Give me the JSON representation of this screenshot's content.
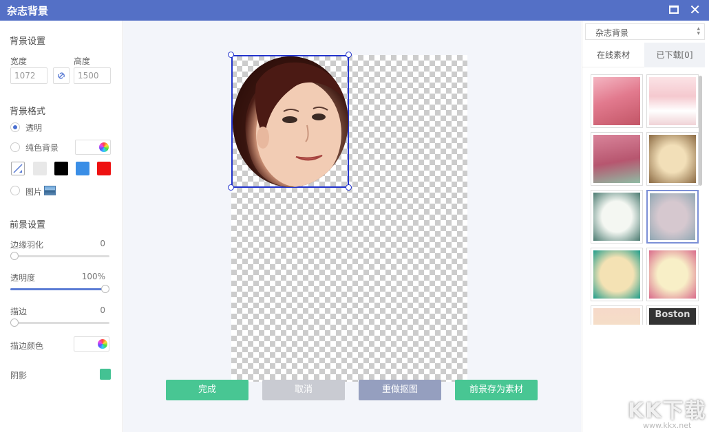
{
  "window": {
    "title": "杂志背景"
  },
  "left": {
    "bg_settings_title": "背景设置",
    "width_label": "宽度",
    "height_label": "高度",
    "width_value": "1072",
    "height_value": "1500",
    "bg_format_title": "背景格式",
    "opt_transparent": "透明",
    "opt_solid": "纯色背景",
    "opt_image": "图片",
    "swatches": [
      "#e8e8e8",
      "#000000",
      "#3a8ee6",
      "#ee1111"
    ],
    "fg_settings_title": "前景设置",
    "feather_label": "边缘羽化",
    "feather_value": "0",
    "feather_level": 0,
    "opacity_label": "透明度",
    "opacity_value": "100%",
    "opacity_level": 100,
    "stroke_label": "描边",
    "stroke_value": "0",
    "stroke_level": 0,
    "stroke_color_label": "描边颜色",
    "shadow_label": "阴影",
    "shadow_color": "#44c293"
  },
  "buttons": {
    "done": "完成",
    "cancel": "取消",
    "redo_cutout": "重做抠图",
    "save_fg": "前景存为素材"
  },
  "right": {
    "category": "杂志背景",
    "tab_online": "在线素材",
    "tab_downloaded": "已下载[0]",
    "thumb_text": {
      "boston": "Boston"
    }
  },
  "watermark": {
    "logo": "KK下载",
    "url": "www.kkx.net"
  }
}
